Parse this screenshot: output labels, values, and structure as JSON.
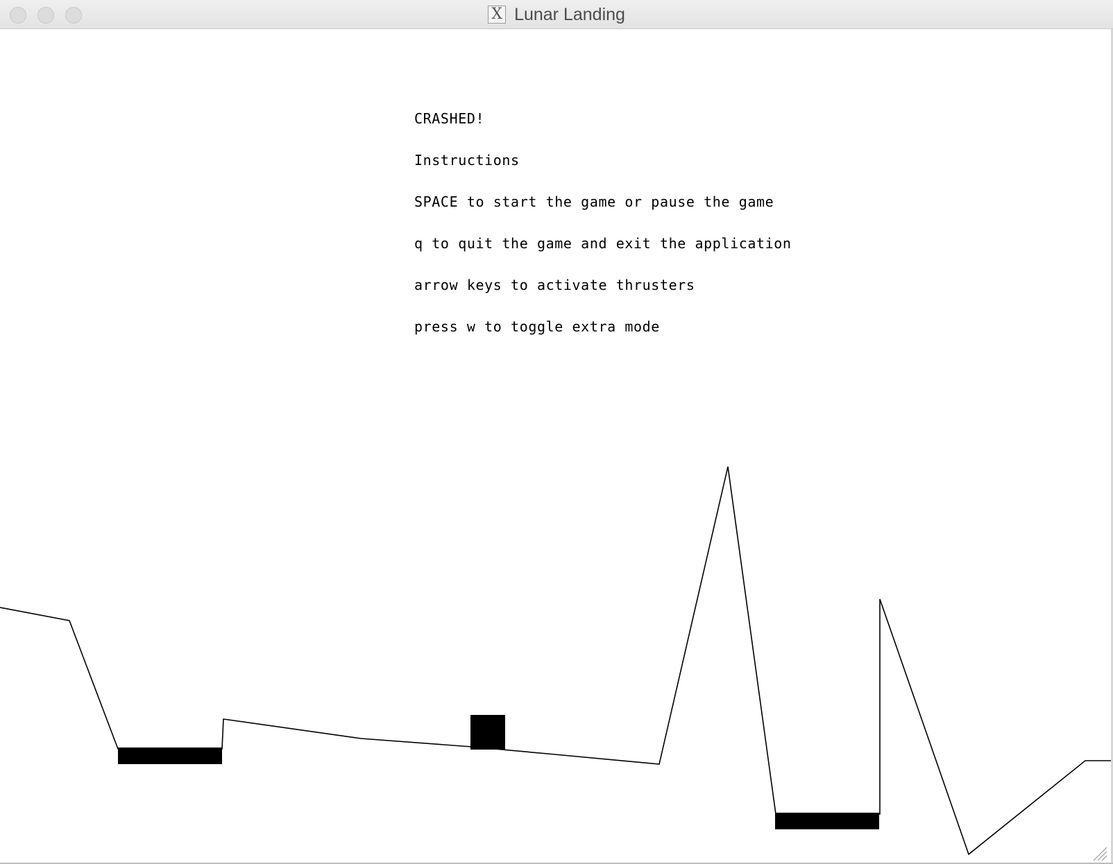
{
  "window": {
    "title": "Lunar Landing",
    "title_icon": "x11-icon",
    "title_icon_glyph": "X"
  },
  "game": {
    "messages": [
      "CRASHED!",
      "Instructions",
      "SPACE to start the game or pause the game",
      "q to quit the game and exit the application",
      "arrow keys to activate thrusters",
      "press w to toggle extra mode"
    ],
    "colors": {
      "background": "#ffffff",
      "terrain": "#000000",
      "landing_pad": "#000000",
      "lander": "#000000"
    },
    "landing_pad_count": 2,
    "state": "crashed"
  }
}
